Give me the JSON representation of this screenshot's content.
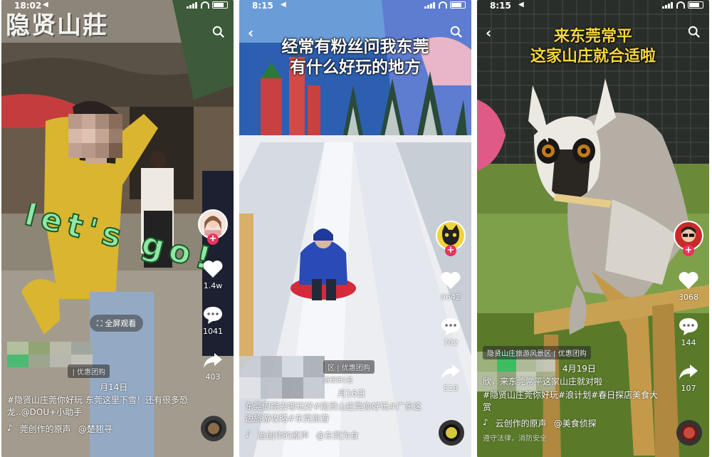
{
  "panels": [
    {
      "status_time": "18:02",
      "status_location": "◀",
      "sign_text": "隐贤山莊",
      "overlay_sticker": "let's go!",
      "fullscreen_label": "全屏观看",
      "likes": "1.4w",
      "comments": "1041",
      "shares": "403",
      "tag_label": "| 优惠团购",
      "date": "月14日",
      "caption": "#隐贤山庄莞你好玩 东莞这里下雪！还有很多恐龙..@DOU+小助手",
      "music": "莞创作的原声",
      "music_author": "@楚翘寻"
    },
    {
      "status_time": "8:15",
      "status_location": "◀",
      "overlay_title_line1": "经常有粉丝问我东莞",
      "overlay_title_line2": "有什么好玩的地方",
      "likes": "9642",
      "comments": "702",
      "shares": "518",
      "tag_label": "区 | 优惠团购",
      "tag_sub": "道榜第1名",
      "date": "月16日",
      "caption": "东莞假期去哪玩好#隐贤山庄莞你好玩#广东这边旅游攻略#东莞旅游",
      "music": "溢创作的原声",
      "music_author": "@东莞为食"
    },
    {
      "status_time": "8:15",
      "status_location": "◀",
      "overlay_title_line1": "来东莞常平",
      "overlay_title_line2": "这家山庄就合适啦",
      "likes": "3068",
      "comments": "144",
      "shares": "107",
      "tag_label": "隐贤山庄旅游风景区 | 优惠团购",
      "date": "4月19日",
      "caption": "#隐贤山庄莞你好玩#浪计划#春日探店美食大赏",
      "caption_prefix": "欣，来东莞常平这家山庄就对啦",
      "music": "云创作的原声",
      "music_author": "@美食侦探",
      "footer_note": "遵守法律，消防安全"
    }
  ],
  "colors": {
    "heart": "#ffffff",
    "plus_badge": "#e8345b",
    "title_yellow": "#f5d63a",
    "sticker_green": "#8fe8a4"
  }
}
